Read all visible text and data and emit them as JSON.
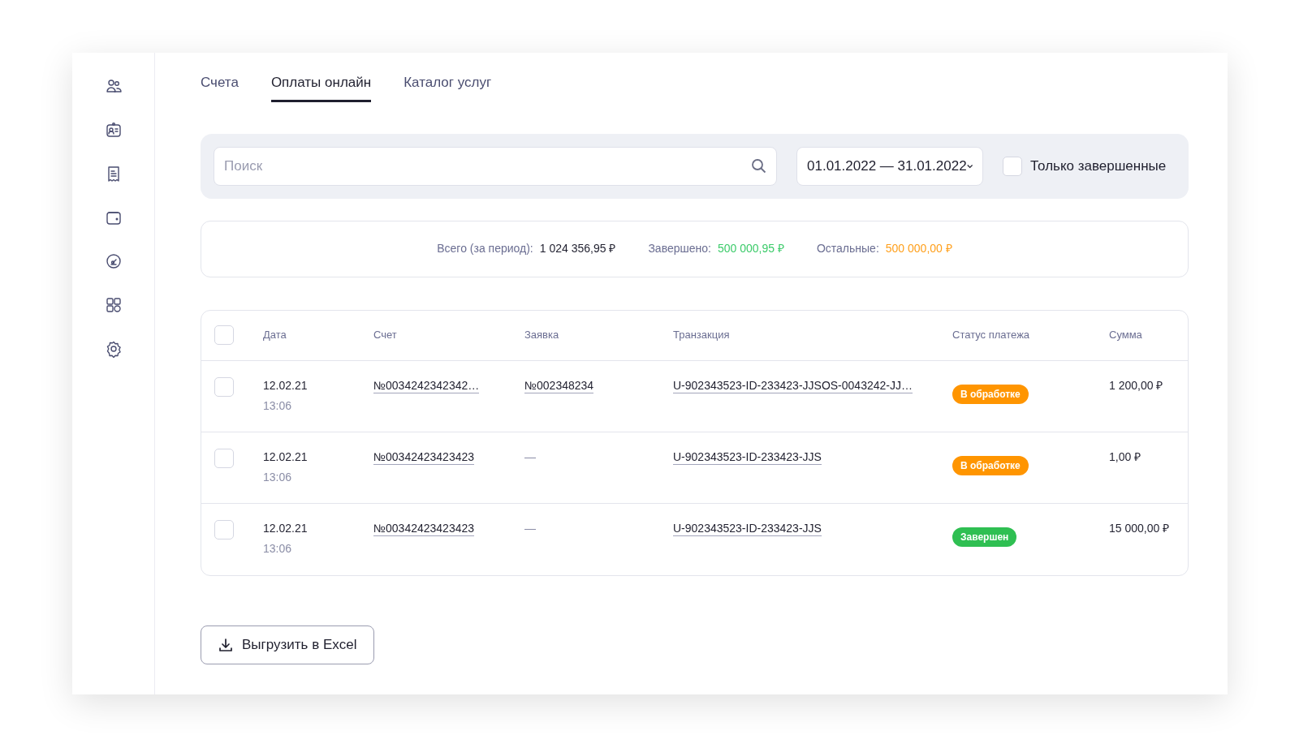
{
  "sidebar": {
    "items": [
      {
        "selected": false
      },
      {
        "selected": false
      },
      {
        "selected": false
      },
      {
        "selected": false
      },
      {
        "selected": false
      },
      {
        "selected": false
      },
      {
        "selected": false
      }
    ]
  },
  "tabs": [
    {
      "label": "Счета",
      "selected": false
    },
    {
      "label": "Оплаты онлайн",
      "selected": true
    },
    {
      "label": "Каталог услуг",
      "selected": false
    }
  ],
  "filters": {
    "search": {
      "placeholder": "Поиск"
    },
    "period": "01.01.2022 — 31.01.2022",
    "only_completed": {
      "label": "Только завершенные",
      "checked": false
    }
  },
  "summary": [
    {
      "label": "Всего (за период):",
      "value": "1 024 356,95 ₽",
      "color": "#1f1f2e"
    },
    {
      "label": "Завершено:",
      "value": "500 000,95 ₽",
      "color": "#3ccb6a"
    },
    {
      "label": "Остальные:",
      "value": "500 000,00 ₽",
      "color": "#ff9f1a"
    }
  ],
  "table": {
    "select_all": false,
    "columns": [
      "Дата",
      "Счет",
      "Заявка",
      "Транзакция",
      "Статус платежа",
      "Сумма"
    ],
    "rows": [
      {
        "selected": false,
        "date": "12.02.21",
        "time": "13:06",
        "invoice": "№0034242342342…",
        "request": "№002348234",
        "request_link": true,
        "transaction": "U-902343523-ID-233423-JJSOS-0043242-JJ…",
        "status": {
          "kind": "processing",
          "label": "В обработке"
        },
        "amount": "1 200,00 ₽"
      },
      {
        "selected": false,
        "date": "12.02.21",
        "time": "13:06",
        "invoice": "№00342423423423",
        "request": "—",
        "request_link": false,
        "transaction": "U-902343523-ID-233423-JJS",
        "status": {
          "kind": "processing",
          "label": "В обработке"
        },
        "amount": "1,00 ₽"
      },
      {
        "selected": false,
        "date": "12.02.21",
        "time": "13:06",
        "invoice": "№00342423423423",
        "request": "—",
        "request_link": false,
        "transaction": "U-902343523-ID-233423-JJS",
        "status": {
          "kind": "done",
          "label": "Завершен"
        },
        "amount": "15 000,00 ₽"
      }
    ]
  },
  "export_button": "Выгрузить в Excel"
}
